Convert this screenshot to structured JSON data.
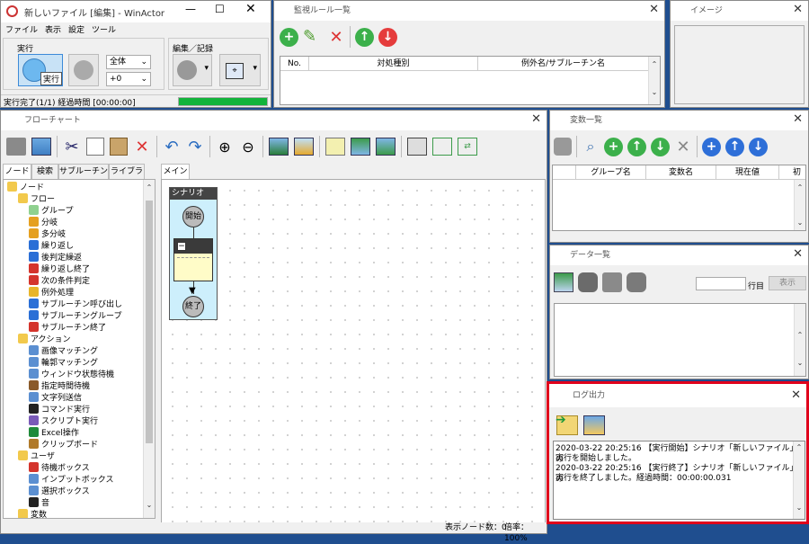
{
  "main_window": {
    "title": "新しいファイル [編集] - WinActor",
    "menu": [
      "ファイル",
      "表示",
      "設定",
      "ツール"
    ],
    "run_group_label": "実行",
    "run_button_tooltip": "実行",
    "scope_select": "全体",
    "speed_select": "+0",
    "edit_group_label": "編集／記録",
    "status": "実行完了(1/1) 経過時間 [00:00:00]",
    "progress": 1.0
  },
  "rule_window": {
    "title": "監視ルール一覧",
    "columns": [
      "No.",
      "対処種別",
      "例外名/サブルーチン名"
    ]
  },
  "image_window": {
    "title": "イメージ"
  },
  "flowchart_window": {
    "title": "フローチャート",
    "left_tabs": [
      "ノード",
      "検索",
      "サブルーチン",
      "ライブラリ"
    ],
    "main_tab": "メイン",
    "scenario_label": "シナリオ",
    "start_label": "開始",
    "end_label": "終了",
    "status_nodes": "表示ノード数：0",
    "status_zoom": "倍率：100%",
    "tree": [
      {
        "label": "ノード",
        "level": 0,
        "icon": "folder"
      },
      {
        "label": "フロー",
        "level": 1,
        "icon": "folder"
      },
      {
        "label": "グループ",
        "level": 2,
        "icon": "group"
      },
      {
        "label": "分岐",
        "level": 2,
        "icon": "branch"
      },
      {
        "label": "多分岐",
        "level": 2,
        "icon": "multibranch"
      },
      {
        "label": "繰り返し",
        "level": 2,
        "icon": "loop"
      },
      {
        "label": "後判定繰返",
        "level": 2,
        "icon": "loop"
      },
      {
        "label": "繰り返し終了",
        "level": 2,
        "icon": "loop-end"
      },
      {
        "label": "次の条件判定",
        "level": 2,
        "icon": "next"
      },
      {
        "label": "例外処理",
        "level": 2,
        "icon": "exception"
      },
      {
        "label": "サブルーチン呼び出し",
        "level": 2,
        "icon": "sub"
      },
      {
        "label": "サブルーチングループ",
        "level": 2,
        "icon": "sub"
      },
      {
        "label": "サブルーチン終了",
        "level": 2,
        "icon": "sub-end"
      },
      {
        "label": "アクション",
        "level": 1,
        "icon": "folder"
      },
      {
        "label": "画像マッチング",
        "level": 2,
        "icon": "image"
      },
      {
        "label": "輪郭マッチング",
        "level": 2,
        "icon": "image"
      },
      {
        "label": "ウィンドウ状態待機",
        "level": 2,
        "icon": "window"
      },
      {
        "label": "指定時間待機",
        "level": 2,
        "icon": "timer"
      },
      {
        "label": "文字列送信",
        "level": 2,
        "icon": "text"
      },
      {
        "label": "コマンド実行",
        "level": 2,
        "icon": "command"
      },
      {
        "label": "スクリプト実行",
        "level": 2,
        "icon": "script"
      },
      {
        "label": "Excel操作",
        "level": 2,
        "icon": "excel"
      },
      {
        "label": "クリップボード",
        "level": 2,
        "icon": "clipboard"
      },
      {
        "label": "ユーザ",
        "level": 1,
        "icon": "folder"
      },
      {
        "label": "待機ボックス",
        "level": 2,
        "icon": "wait"
      },
      {
        "label": "インプットボックス",
        "level": 2,
        "icon": "input"
      },
      {
        "label": "選択ボックス",
        "level": 2,
        "icon": "select"
      },
      {
        "label": "音",
        "level": 2,
        "icon": "sound"
      },
      {
        "label": "変数",
        "level": 1,
        "icon": "folder"
      }
    ]
  },
  "variable_window": {
    "title": "変数一覧",
    "columns": [
      "グループ名",
      "変数名",
      "現在値",
      "初"
    ]
  },
  "data_window": {
    "title": "データ一覧",
    "row_suffix": "行目",
    "show_button": "表示",
    "row_value": ""
  },
  "log_window": {
    "title": "ログ出力",
    "lines": [
      "2020-03-22 20:25:16 【実行開始】シナリオ「新しいファイル」の",
      "実行を開始しました。",
      "2020-03-22 20:25:16 【実行終了】シナリオ「新しいファイル」の",
      "実行を終了しました。経過時間：00:00:00.031"
    ],
    "highlight_color": "#e0001b"
  }
}
